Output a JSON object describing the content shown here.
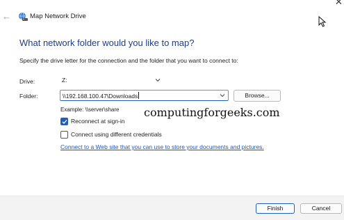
{
  "window": {
    "title": "Map Network Drive",
    "close_glyph": "✕",
    "back_glyph": "←",
    "title_icon": "network-drive-icon"
  },
  "dialog": {
    "heading": "What network folder would you like to map?",
    "instruction": "Specify the drive letter for the connection and the folder that you want to connect to:",
    "drive_label": "Drive:",
    "drive_value": "Z:",
    "folder_label": "Folder:",
    "folder_value": "\\\\192.168.100.47\\Downloads",
    "browse_label": "Browse...",
    "example": "Example: \\\\server\\share",
    "reconnect_label": "Reconnect at sign-in",
    "reconnect_checked": true,
    "credentials_label": "Connect using different credentials",
    "credentials_checked": false,
    "link_text": "Connect to a Web site that you can use to store your documents and pictures."
  },
  "watermark": "computingforgeeks.com",
  "footer": {
    "finish_label": "Finish",
    "cancel_label": "Cancel"
  },
  "colors": {
    "heading": "#1a3d8f",
    "accent": "#1f5fbf",
    "link": "#1a56c2"
  }
}
